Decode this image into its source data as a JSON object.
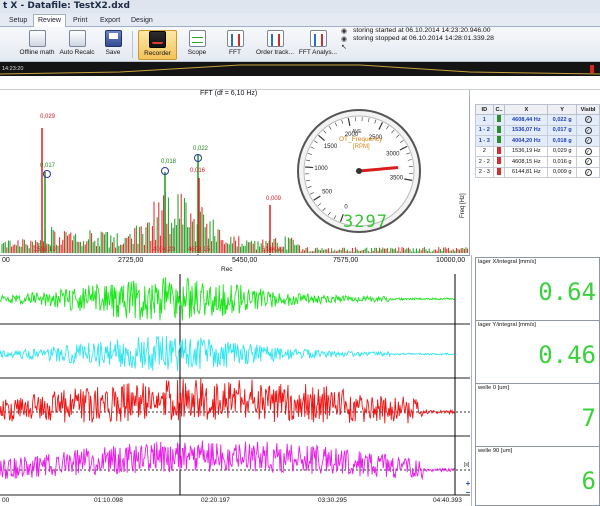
{
  "window": {
    "title": "t X - Datafile: TestX2.dxd"
  },
  "tabs": [
    {
      "label": "Setup"
    },
    {
      "label": "Review"
    },
    {
      "label": "Print"
    },
    {
      "label": "Export"
    },
    {
      "label": "Design"
    }
  ],
  "ribbon": {
    "offline_math": "Offline math",
    "auto_recalc": "Auto Recalc",
    "save": "Save",
    "recorder": "Recorder",
    "scope": "Scope",
    "fft": "FFT",
    "order_track": "Order track...",
    "fft_analysis": "FFT Analys..."
  },
  "log": {
    "line1": "storing started at 06.10.2014 14:23:20.946.00",
    "line2": "storing stopped at 06.10.2014 14:28:01.339.28"
  },
  "overview": {
    "time_start": "14:23:20"
  },
  "fft": {
    "title": "FFT (df = 6,10 Hz)",
    "y_unit": "Freq [Hz]",
    "x_ticks": [
      "00",
      "2725,00",
      "5450,00",
      "7575,00",
      "10000,00"
    ],
    "marker_freqs": [
      "1536,19",
      "4004,20",
      "4608,15",
      "6144,81"
    ],
    "marker_labels": [
      "0,029",
      "0,017",
      "0,018",
      "0,022",
      "0,016",
      "0,009"
    ]
  },
  "gauge": {
    "unit_top": "AVE",
    "label": "OT_Frequency",
    "unit": "[RPM]",
    "ticks": [
      "0",
      "500",
      "1000",
      "1500",
      "2000",
      "2500",
      "3000",
      "3500"
    ],
    "digital_value": "3297",
    "value": 3297,
    "max": 3500
  },
  "table": {
    "headers": [
      "ID",
      "C..",
      "X",
      "Y",
      "Visibl"
    ],
    "rows": [
      {
        "id": "1",
        "x": "4608,44 Hz",
        "y": "0,022 g",
        "color": "#2a8f2a"
      },
      {
        "id": "1 - 2",
        "x": "1536,07 Hz",
        "y": "0,017 g",
        "color": "#2a8f2a"
      },
      {
        "id": "1 - 3",
        "x": "4004,20 Hz",
        "y": "0,018 g",
        "color": "#2a8f2a"
      },
      {
        "id": "2",
        "x": "1536,19 Hz",
        "y": "0,029 g",
        "color": "#d23030"
      },
      {
        "id": "2 - 2",
        "x": "4608,15 Hz",
        "y": "0,016 g",
        "color": "#d23030"
      },
      {
        "id": "2 - 3",
        "x": "6144,81 Hz",
        "y": "0,009 g",
        "color": "#d23030"
      }
    ]
  },
  "recorder": {
    "title": "Rec",
    "time_ticks": [
      "00",
      "01:10.098",
      "02:20.197",
      "03:30.295",
      "04:40.393"
    ],
    "unit_label": "[s]"
  },
  "displays": [
    {
      "label": "lager X/integral [mm/s]",
      "value": "0.64"
    },
    {
      "label": "lager Y/integral [mm/s]",
      "value": "0.46"
    },
    {
      "label": "welle 0 [um]",
      "value": "7"
    },
    {
      "label": "welle 90 [um]",
      "value": "6"
    }
  ],
  "colors": {
    "trace_green": "#19e619",
    "trace_cyan": "#2ee6f0",
    "trace_red": "#ef1414",
    "trace_magenta": "#e61ee6",
    "fft_red": "#e02020",
    "fft_green": "#1d9a1d",
    "digit_green": "#3ad13a"
  }
}
